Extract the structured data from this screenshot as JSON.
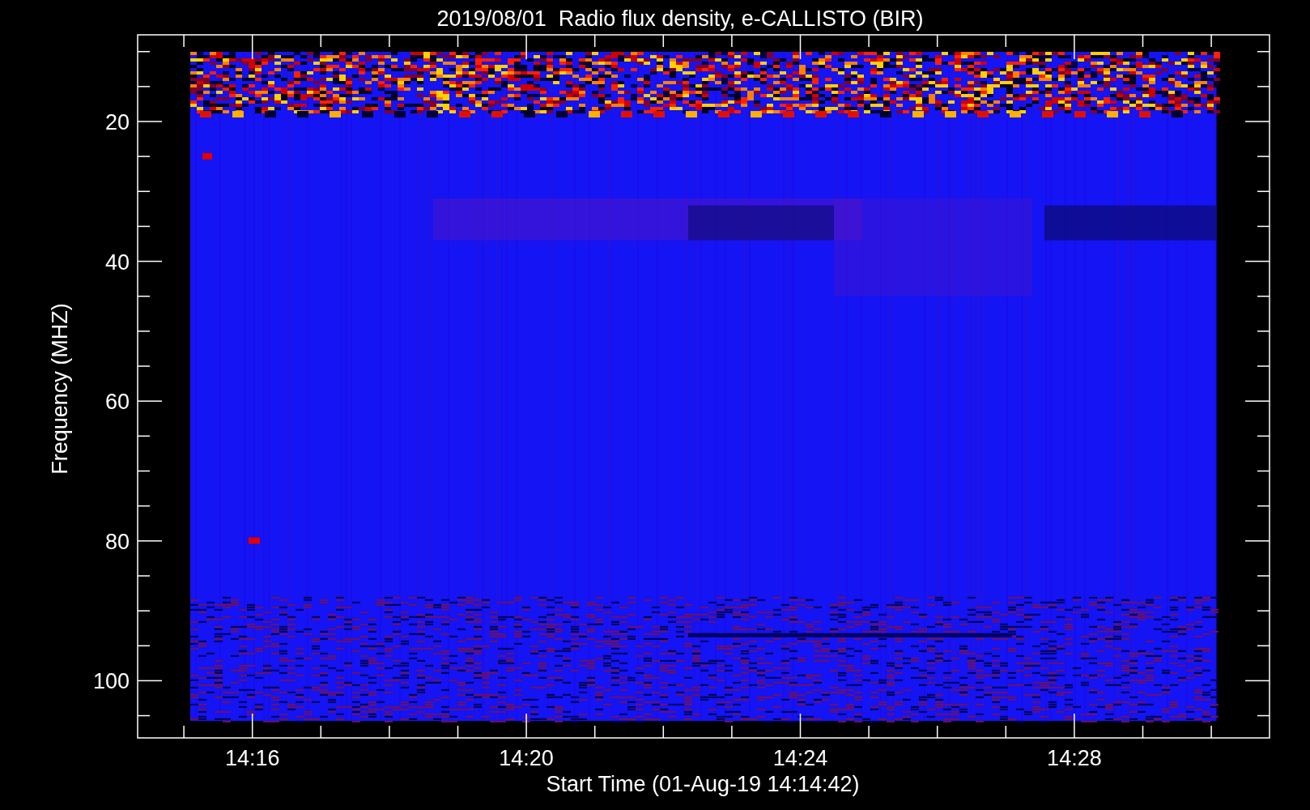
{
  "plot": {
    "title": "2019/08/01  Radio flux density, e-CALLISTO (BIR)",
    "ylabel": "Frequency (MHZ)",
    "xlabel": "Start Time (01-Aug-19 14:14:42)",
    "yticks": [
      "20",
      "40",
      "60",
      "80",
      "100"
    ],
    "xticks": [
      "14:16",
      "14:20",
      "14:24",
      "14:28"
    ]
  }
}
